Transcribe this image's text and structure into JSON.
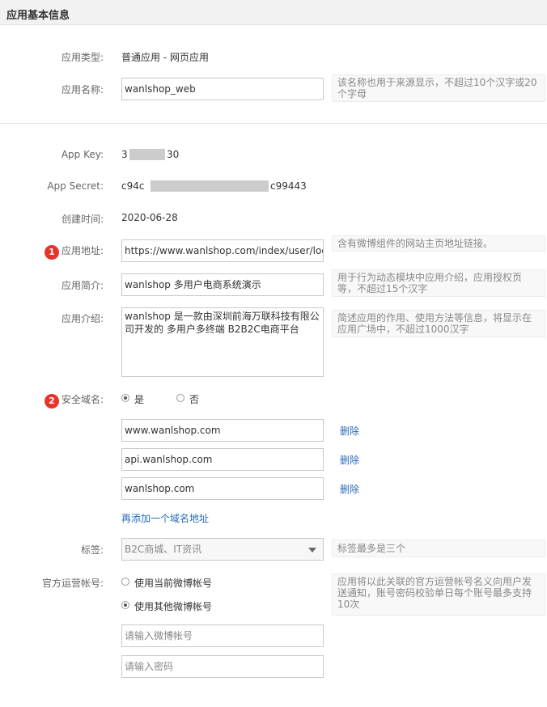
{
  "section": {
    "title": "应用基本信息"
  },
  "fields": {
    "type_label": "应用类型:",
    "type_value": "普通应用 - 网页应用",
    "name_label": "应用名称:",
    "name_value": "wanlshop_web",
    "name_hint": "该名称也用于来源显示，不超过10个汉字或20个字母",
    "appkey_label": "App Key:",
    "appkey_prefix": "3",
    "appkey_suffix": "30",
    "secret_label": "App Secret:",
    "secret_prefix": "c94c",
    "secret_suffix": "c99443",
    "created_label": "创建时间:",
    "created_value": "2020-06-28",
    "url_label": "应用地址:",
    "url_value": "https://www.wanlshop.com/index/user/login.htm",
    "url_hint": "含有微博组件的网站主页地址链接。",
    "brief_label": "应用简介:",
    "brief_value": "wanlshop 多用户电商系统演示",
    "brief_hint": "用于行为动态模块中应用介绍，应用授权页等，不超过15个汉字",
    "intro_label": "应用介绍:",
    "intro_value": "wanlshop 是一款由深圳前海万联科技有限公司开发的 多用户多终端 B2B2C电商平台",
    "intro_hint": "简述应用的作用、使用方法等信息，将显示在应用广场中，不超过1000汉字",
    "domain_label": "安全域名:",
    "domain_yes": "是",
    "domain_no": "否",
    "domains": [
      "www.wanlshop.com",
      "api.wanlshop.com",
      "wanlshop.com"
    ],
    "delete_label": "删除",
    "add_domain": "再添加一个域名地址",
    "tag_label": "标签:",
    "tag_value": "B2C商城、IT资讯",
    "tag_hint": "标签最多是三个",
    "official_label": "官方运营帐号:",
    "official_opt1": "使用当前微博帐号",
    "official_opt2": "使用其他微博帐号",
    "official_hint": "应用将以此关联的官方运营帐号名义向用户发送通知，账号密码校验单日每个账号最多支持10次",
    "weibo_placeholder": "请输入微博帐号",
    "password_placeholder": "请输入密码"
  },
  "badges": [
    "1",
    "2"
  ],
  "colors": {
    "link": "#2a6cb8",
    "badge": "#e8332d"
  }
}
